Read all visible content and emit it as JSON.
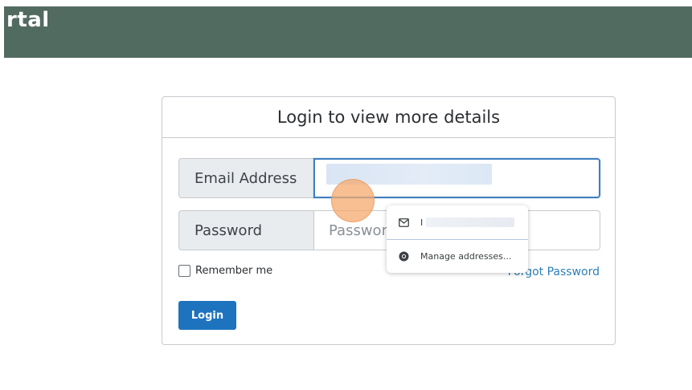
{
  "header": {
    "title": "rtal"
  },
  "card": {
    "title": "Login to view more details",
    "email_label": "Email Address",
    "password_label": "Password",
    "password_placeholder": "Password",
    "remember_label": "Remember me",
    "forgot_label": "Forgot Password",
    "login_label": "Login"
  },
  "autofill": {
    "suggestion_initial": "I",
    "manage_label": "Manage addresses..."
  },
  "colors": {
    "header": "#526b61",
    "primary": "#1e73be",
    "link": "#2d7fb8",
    "focus": "#3f7fbf"
  }
}
